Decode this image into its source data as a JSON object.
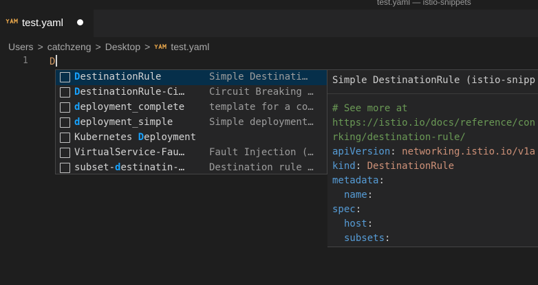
{
  "window": {
    "title": "test.yaml — istio-snippets"
  },
  "tab": {
    "icon": "yaml-file-icon",
    "label": "test.yaml"
  },
  "breadcrumb": {
    "items": [
      "Users",
      "catchzeng",
      "Desktop",
      "test.yaml"
    ],
    "separator": ">"
  },
  "editor": {
    "line_number": "1",
    "text": "D"
  },
  "suggest": {
    "items": [
      {
        "match": "D",
        "rest": "estinationRule",
        "prefix": "",
        "detail": "Simple Destinati…"
      },
      {
        "match": "D",
        "rest": "estinationRule-Ci…",
        "prefix": "",
        "detail": "Circuit Breaking …"
      },
      {
        "match": "d",
        "rest": "eployment_complete",
        "prefix": "",
        "detail": "template for a co…"
      },
      {
        "match": "d",
        "rest": "eployment_simple",
        "prefix": "",
        "detail": "Simple deployment…"
      },
      {
        "match": "D",
        "rest": "eployment",
        "prefix": "Kubernetes ",
        "detail": ""
      },
      {
        "match": "",
        "rest": "VirtualService-Fau…",
        "prefix": "",
        "detail": "Fault Injection (…"
      },
      {
        "match": "d",
        "rest": "estinatin-…",
        "prefix": "subset-",
        "detail": "Destination rule …"
      }
    ]
  },
  "details": {
    "title": "Simple DestinationRule (istio-snipp",
    "comment1": "# See more at",
    "comment2": "https://istio.io/docs/reference/con",
    "comment3": "rking/destination-rule/",
    "api_key": "apiVersion",
    "api_val": "networking.istio.io/v1a",
    "kind_key": "kind",
    "kind_val": "DestinationRule",
    "metadata_key": "metadata",
    "name_key": "name",
    "spec_key": "spec",
    "host_key": "host",
    "subsets_key": "subsets",
    "colon": ":"
  },
  "colors": {
    "focused_row": "#062f4a",
    "match_highlight": "#18a3ff",
    "yaml_key": "#569cd6",
    "yaml_value": "#ce9178",
    "comment": "#6a9955"
  }
}
